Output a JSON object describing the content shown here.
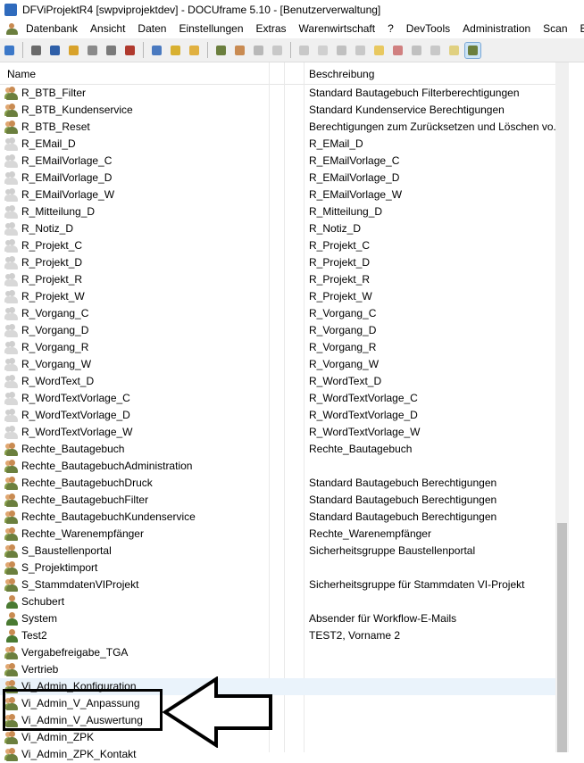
{
  "window": {
    "title": "DFViProjektR4 [swpviprojektdev] - DOCUframe 5.10 - [Benutzerverwaltung]"
  },
  "menu": [
    "Datenbank",
    "Ansicht",
    "Daten",
    "Einstellungen",
    "Extras",
    "Warenwirtschaft",
    "?",
    "DevTools",
    "Administration",
    "Scan",
    "Be"
  ],
  "toolbar": {
    "icons": [
      "new-doc-icon",
      "card-icon",
      "list-icon",
      "folder-icon",
      "tag-icon",
      "copy-icon",
      "calendar-icon",
      "page-icon",
      "mail-icon",
      "folder-open-icon",
      "user-add-icon",
      "user-group-icon",
      "user-remove-icon",
      "user-ghost-icon",
      "tools-icon",
      "pointer-icon",
      "glasses-icon",
      "check-icon",
      "sun-icon",
      "x-icon",
      "handshake-icon",
      "pen-icon",
      "star-icon",
      "user-icon"
    ]
  },
  "grid": {
    "columns": {
      "name": "Name",
      "description": "Beschreibung"
    },
    "rows": [
      {
        "name": "R_BTB_Filter",
        "description": "Standard Bautagebuch Filterberechtigungen",
        "icon": "group-icon"
      },
      {
        "name": "R_BTB_Kundenservice",
        "description": "Standard Kundenservice Berechtigungen",
        "icon": "group-icon"
      },
      {
        "name": "R_BTB_Reset",
        "description": "Berechtigungen zum Zurücksetzen und Löschen vo...",
        "icon": "group-icon"
      },
      {
        "name": "R_EMail_D",
        "description": "R_EMail_D",
        "icon": "group-ghost-icon"
      },
      {
        "name": "R_EMailVorlage_C",
        "description": "R_EMailVorlage_C",
        "icon": "group-ghost-icon"
      },
      {
        "name": "R_EMailVorlage_D",
        "description": "R_EMailVorlage_D",
        "icon": "group-ghost-icon"
      },
      {
        "name": "R_EMailVorlage_W",
        "description": "R_EMailVorlage_W",
        "icon": "group-ghost-icon"
      },
      {
        "name": "R_Mitteilung_D",
        "description": "R_Mitteilung_D",
        "icon": "group-ghost-icon"
      },
      {
        "name": "R_Notiz_D",
        "description": "R_Notiz_D",
        "icon": "group-ghost-icon"
      },
      {
        "name": "R_Projekt_C",
        "description": "R_Projekt_C",
        "icon": "group-ghost-icon"
      },
      {
        "name": "R_Projekt_D",
        "description": "R_Projekt_D",
        "icon": "group-ghost-icon"
      },
      {
        "name": "R_Projekt_R",
        "description": "R_Projekt_R",
        "icon": "group-ghost-icon"
      },
      {
        "name": "R_Projekt_W",
        "description": "R_Projekt_W",
        "icon": "group-ghost-icon"
      },
      {
        "name": "R_Vorgang_C",
        "description": "R_Vorgang_C",
        "icon": "group-ghost-icon"
      },
      {
        "name": "R_Vorgang_D",
        "description": "R_Vorgang_D",
        "icon": "group-ghost-icon"
      },
      {
        "name": "R_Vorgang_R",
        "description": "R_Vorgang_R",
        "icon": "group-ghost-icon"
      },
      {
        "name": "R_Vorgang_W",
        "description": "R_Vorgang_W",
        "icon": "group-ghost-icon"
      },
      {
        "name": "R_WordText_D",
        "description": "R_WordText_D",
        "icon": "group-ghost-icon"
      },
      {
        "name": "R_WordTextVorlage_C",
        "description": "R_WordTextVorlage_C",
        "icon": "group-ghost-icon"
      },
      {
        "name": "R_WordTextVorlage_D",
        "description": "R_WordTextVorlage_D",
        "icon": "group-ghost-icon"
      },
      {
        "name": "R_WordTextVorlage_W",
        "description": "R_WordTextVorlage_W",
        "icon": "group-ghost-icon"
      },
      {
        "name": "Rechte_Bautagebuch",
        "description": "Rechte_Bautagebuch",
        "icon": "group-icon"
      },
      {
        "name": "Rechte_BautagebuchAdministration",
        "description": "",
        "icon": "group-icon"
      },
      {
        "name": "Rechte_BautagebuchDruck",
        "description": "Standard Bautagebuch Berechtigungen",
        "icon": "group-icon"
      },
      {
        "name": "Rechte_BautagebuchFilter",
        "description": "Standard Bautagebuch Berechtigungen",
        "icon": "group-icon"
      },
      {
        "name": "Rechte_BautagebuchKundenservice",
        "description": "Standard Bautagebuch Berechtigungen",
        "icon": "group-icon"
      },
      {
        "name": "Rechte_Warenempfänger",
        "description": "Rechte_Warenempfänger",
        "icon": "group-icon"
      },
      {
        "name": "S_Baustellenportal",
        "description": "Sicherheitsgruppe Baustellenportal",
        "icon": "group-icon"
      },
      {
        "name": "S_Projektimport",
        "description": "",
        "icon": "group-icon"
      },
      {
        "name": "S_StammdatenVIProjekt",
        "description": "Sicherheitsgruppe für Stammdaten VI-Projekt",
        "icon": "group-icon"
      },
      {
        "name": "Schubert",
        "description": "",
        "icon": "user-icon"
      },
      {
        "name": "System",
        "description": "Absender für Workflow-E-Mails",
        "icon": "user-icon"
      },
      {
        "name": "Test2",
        "description": "TEST2, Vorname 2",
        "icon": "user-icon"
      },
      {
        "name": "Vergabefreigabe_TGA",
        "description": "",
        "icon": "group-icon"
      },
      {
        "name": "Vertrieb",
        "description": "",
        "icon": "group-icon"
      },
      {
        "name": "Vi_Admin_Konfiguration",
        "description": "",
        "icon": "group-icon"
      },
      {
        "name": "Vi_Admin_V_Anpassung",
        "description": "",
        "icon": "group-icon"
      },
      {
        "name": "Vi_Admin_V_Auswertung",
        "description": "",
        "icon": "group-icon"
      },
      {
        "name": "Vi_Admin_ZPK",
        "description": "",
        "icon": "group-icon"
      },
      {
        "name": "Vi_Admin_ZPK_Kontakt",
        "description": "",
        "icon": "group-icon"
      }
    ]
  },
  "colors": {
    "accent": "#2f6bbd",
    "highlight_row": "#eaf3fb",
    "callout": "#000000"
  }
}
